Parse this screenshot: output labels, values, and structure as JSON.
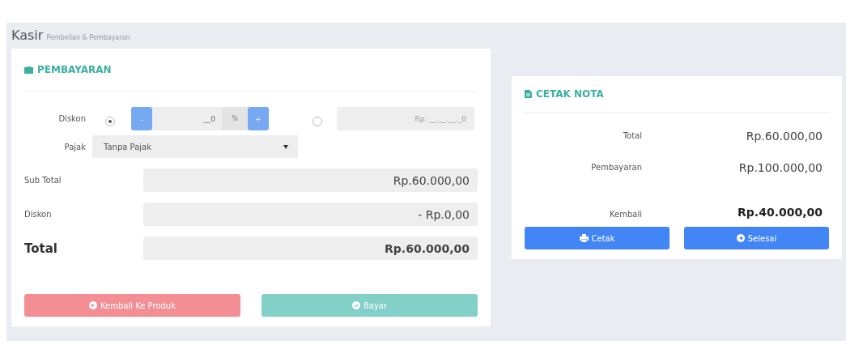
{
  "page": {
    "title": "Kasir",
    "subtitle": "Pembelian & Pembayaran"
  },
  "payment": {
    "title": "PEMBAYARAN",
    "discount": {
      "label": "Diskon",
      "options": [
        {
          "kind": "percent",
          "selected": true,
          "minus": "-",
          "value": "__0",
          "unit": "%",
          "plus": "+"
        },
        {
          "kind": "amount",
          "selected": false,
          "placeholder": "Rp. __.__.__._0"
        }
      ]
    },
    "tax": {
      "label": "Pajak",
      "value": "Tanpa Pajak"
    },
    "summary": [
      {
        "kind": "line",
        "label": "Sub Total",
        "value": "Rp.60.000,00"
      },
      {
        "kind": "line",
        "label": "Diskon",
        "value": "- Rp.0,00"
      },
      {
        "kind": "total",
        "label": "Total",
        "value": "Rp.60.000,00"
      }
    ],
    "buttons": [
      {
        "kind": "back",
        "label": "Kembali Ke Produk"
      },
      {
        "kind": "pay",
        "label": "Bayar"
      }
    ]
  },
  "receipt": {
    "title": "CETAK NOTA",
    "rows": [
      {
        "kind": "line",
        "label": "Total",
        "value": "Rp.60.000,00"
      },
      {
        "kind": "line",
        "label": "Pembayaran",
        "value": "Rp.100.000,00"
      },
      {
        "kind": "total",
        "label": "Kembali",
        "value": "Rp.40.000,00"
      }
    ],
    "buttons": [
      {
        "kind": "print",
        "label": "Cetak"
      },
      {
        "kind": "done",
        "label": "Selesai"
      }
    ]
  }
}
